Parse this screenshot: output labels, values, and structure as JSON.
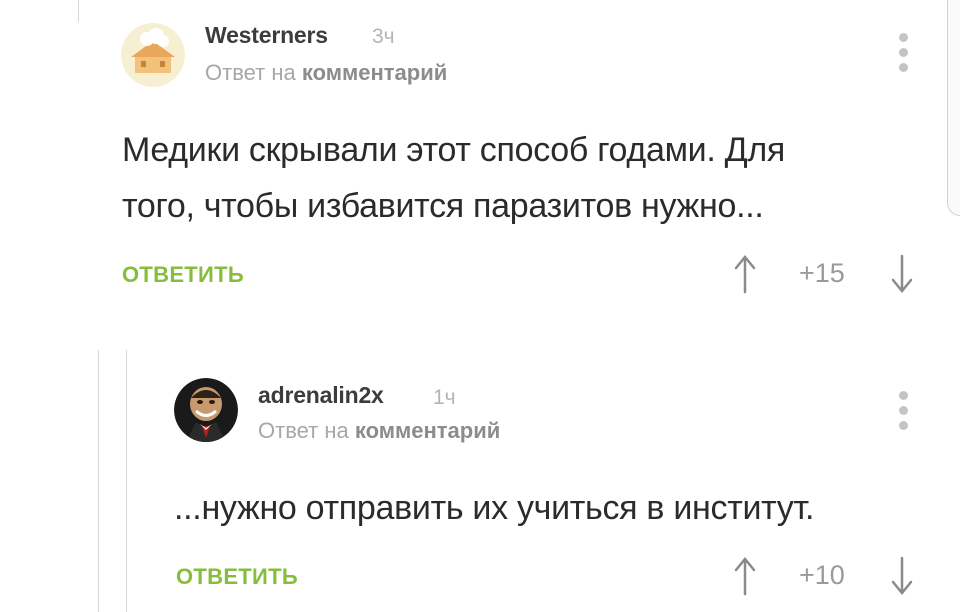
{
  "comments": [
    {
      "author": "Westerners",
      "time": "3ч",
      "reply_prefix": "Ответ на",
      "reply_target": "комментарий",
      "text_lines": [
        "Медики скрывали этот способ годами. Для",
        "того, чтобы избавится паразитов нужно..."
      ],
      "reply_label": "ОТВЕТИТЬ",
      "score": "+15"
    },
    {
      "author": "adrenalin2x",
      "time": "1ч",
      "reply_prefix": "Ответ на",
      "reply_target": "комментарий",
      "text_lines": [
        "...нужно отправить их учиться в институт."
      ],
      "reply_label": "ОТВЕТИТЬ",
      "score": "+10"
    }
  ],
  "colors": {
    "accent": "#87bd3c",
    "text": "#2b2b2b",
    "muted": "#a7a7a7"
  },
  "icons": [
    "more-vertical-icon",
    "arrow-up-icon",
    "arrow-down-icon"
  ]
}
